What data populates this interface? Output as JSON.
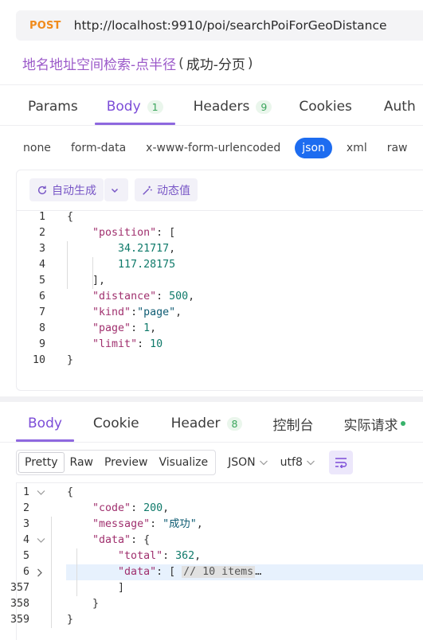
{
  "request": {
    "method": "POST",
    "url": "http://localhost:9910/poi/searchPoiForGeoDistance",
    "title_name": "地名地址空间检索-点半径",
    "title_open": "(",
    "title_sub": "成功-分页",
    "title_close": ")"
  },
  "request_tabs": [
    {
      "label": "Params",
      "badge": null,
      "active": false
    },
    {
      "label": "Body",
      "badge": "1",
      "active": true
    },
    {
      "label": "Headers",
      "badge": "9",
      "active": false
    },
    {
      "label": "Cookies",
      "badge": null,
      "active": false
    },
    {
      "label": "Auth",
      "badge": null,
      "active": false
    }
  ],
  "body_types": [
    "none",
    "form-data",
    "x-www-form-urlencoded",
    "json",
    "xml",
    "raw"
  ],
  "body_type_selected": "json",
  "editor_toolbar": {
    "auto_generate": "自动生成",
    "dynamic_value": "动态值"
  },
  "request_body_lines": [
    {
      "n": "1",
      "tokens": [
        [
          "p",
          "{"
        ]
      ]
    },
    {
      "n": "2",
      "tokens": [
        [
          "p",
          "    "
        ],
        [
          "k",
          "\"position\""
        ],
        [
          "p",
          ": ["
        ]
      ]
    },
    {
      "n": "3",
      "tokens": [
        [
          "p",
          "        "
        ],
        [
          "n",
          "34.21717"
        ],
        [
          "p",
          ","
        ]
      ]
    },
    {
      "n": "4",
      "tokens": [
        [
          "p",
          "        "
        ],
        [
          "n",
          "117.28175"
        ]
      ]
    },
    {
      "n": "5",
      "tokens": [
        [
          "p",
          "    ],"
        ]
      ]
    },
    {
      "n": "6",
      "tokens": [
        [
          "p",
          "    "
        ],
        [
          "k",
          "\"distance\""
        ],
        [
          "p",
          ": "
        ],
        [
          "n",
          "500"
        ],
        [
          "p",
          ","
        ]
      ]
    },
    {
      "n": "7",
      "tokens": [
        [
          "p",
          "    "
        ],
        [
          "k",
          "\"kind\""
        ],
        [
          "p",
          ":"
        ],
        [
          "s",
          "\"page\""
        ],
        [
          "p",
          ","
        ]
      ]
    },
    {
      "n": "8",
      "tokens": [
        [
          "p",
          "    "
        ],
        [
          "k",
          "\"page\""
        ],
        [
          "p",
          ": "
        ],
        [
          "n",
          "1"
        ],
        [
          "p",
          ","
        ]
      ]
    },
    {
      "n": "9",
      "tokens": [
        [
          "p",
          "    "
        ],
        [
          "k",
          "\"limit\""
        ],
        [
          "p",
          ": "
        ],
        [
          "n",
          "10"
        ]
      ]
    },
    {
      "n": "10",
      "tokens": [
        [
          "p",
          "}"
        ]
      ]
    }
  ],
  "response_tabs": [
    {
      "label": "Body",
      "badge": null,
      "active": true
    },
    {
      "label": "Cookie",
      "badge": null,
      "active": false
    },
    {
      "label": "Header",
      "badge": "8",
      "active": false
    },
    {
      "label": "控制台",
      "badge": null,
      "active": false
    },
    {
      "label": "实际请求",
      "badge": null,
      "active": false,
      "dot": true
    }
  ],
  "response_views": [
    "Pretty",
    "Raw",
    "Preview",
    "Visualize"
  ],
  "response_view_selected": "Pretty",
  "response_format": "JSON",
  "response_encoding": "utf8",
  "response_lines": [
    {
      "n": "1",
      "fold": "open",
      "tokens": [
        [
          "p",
          "{"
        ]
      ]
    },
    {
      "n": "2",
      "fold": null,
      "tokens": [
        [
          "p",
          "    "
        ],
        [
          "k",
          "\"code\""
        ],
        [
          "p",
          ": "
        ],
        [
          "n",
          "200"
        ],
        [
          "p",
          ","
        ]
      ]
    },
    {
      "n": "3",
      "fold": null,
      "tokens": [
        [
          "p",
          "    "
        ],
        [
          "k",
          "\"message\""
        ],
        [
          "p",
          ": "
        ],
        [
          "s",
          "\"成功\""
        ],
        [
          "p",
          ","
        ]
      ]
    },
    {
      "n": "4",
      "fold": "open",
      "tokens": [
        [
          "p",
          "    "
        ],
        [
          "k",
          "\"data\""
        ],
        [
          "p",
          ": {"
        ]
      ]
    },
    {
      "n": "5",
      "fold": null,
      "tokens": [
        [
          "p",
          "        "
        ],
        [
          "k",
          "\"total\""
        ],
        [
          "p",
          ": "
        ],
        [
          "n",
          "362"
        ],
        [
          "p",
          ","
        ]
      ]
    },
    {
      "n": "6",
      "fold": "closed",
      "highlight": true,
      "tokens": [
        [
          "p",
          "        "
        ],
        [
          "k",
          "\"data\""
        ],
        [
          "p",
          ": [ "
        ],
        [
          "chip",
          "// 10 items"
        ],
        [
          "p",
          "…"
        ]
      ]
    },
    {
      "n": "357",
      "fold": null,
      "tokens": [
        [
          "p",
          "        ]"
        ]
      ]
    },
    {
      "n": "358",
      "fold": null,
      "tokens": [
        [
          "p",
          "    }"
        ]
      ]
    },
    {
      "n": "359",
      "fold": null,
      "tokens": [
        [
          "p",
          "}"
        ]
      ]
    }
  ],
  "colors": {
    "accent_purple": "#7c4dd8",
    "method_orange": "#f08b1c",
    "json_pill_blue": "#1d6cf0",
    "badge_green": "#3ba55c"
  }
}
